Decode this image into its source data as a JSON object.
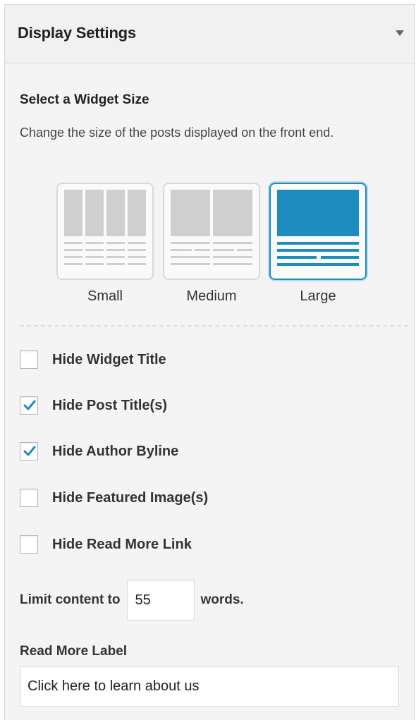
{
  "panel": {
    "title": "Display Settings"
  },
  "widget_size": {
    "heading": "Select a Widget Size",
    "description": "Change the size of the posts displayed on the front end.",
    "options": [
      {
        "label": "Small",
        "selected": false
      },
      {
        "label": "Medium",
        "selected": false
      },
      {
        "label": "Large",
        "selected": true
      }
    ]
  },
  "checkboxes": [
    {
      "label": "Hide Widget Title",
      "checked": false
    },
    {
      "label": "Hide Post Title(s)",
      "checked": true
    },
    {
      "label": "Hide Author Byline",
      "checked": true
    },
    {
      "label": "Hide Featured Image(s)",
      "checked": false
    },
    {
      "label": "Hide Read More Link",
      "checked": false
    }
  ],
  "limit": {
    "label": "Limit content to",
    "value": "55",
    "suffix": "words."
  },
  "read_more": {
    "heading": "Read More Label",
    "value": "Click here to learn about us"
  },
  "colors": {
    "accent": "#1e8cbe",
    "thumb_gray": "#cfcfcf"
  }
}
